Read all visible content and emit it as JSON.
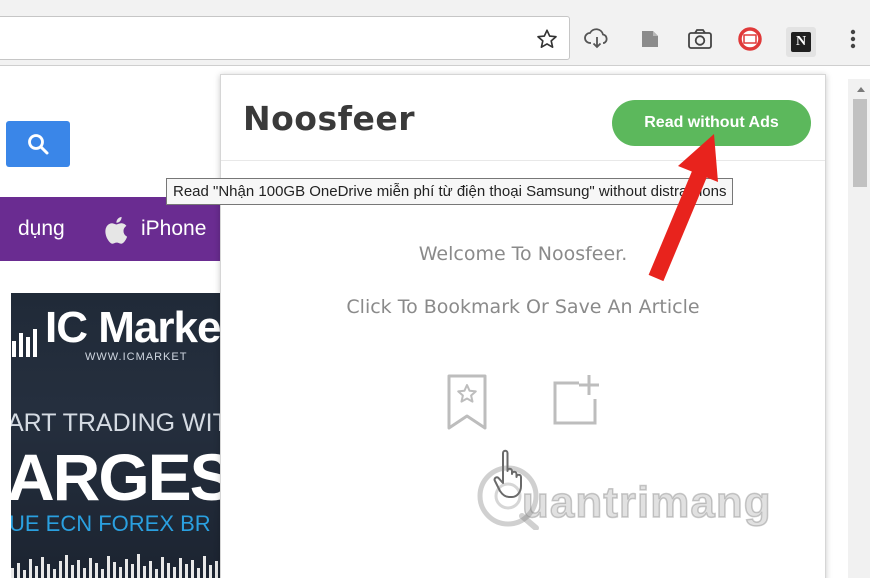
{
  "browser": {
    "toolbar_icons": [
      "star-icon",
      "cloud-download-icon",
      "note-icon",
      "camera-icon",
      "red-circle-icon",
      "noosfeer-extension-icon",
      "menu-icon"
    ],
    "extension_letter": "N"
  },
  "page": {
    "nav": {
      "item1": "dụng",
      "item2": "iPhone"
    },
    "ad": {
      "brand": "IC Marke",
      "url": "WWW.ICMARKET",
      "line1": "ART TRADING WIT",
      "line2": "ARGES",
      "line3": "UE ECN FOREX BR"
    }
  },
  "popup": {
    "logo": "Noosfeer",
    "read_button": "Read without Ads",
    "welcome": "Welcome To Noosfeer.",
    "instruction": "Click To Bookmark Or Save An Article"
  },
  "tooltip": {
    "text": "Read \"Nhận 100GB OneDrive miễn phí từ điện thoại Samsung\" without distractions"
  },
  "watermark": {
    "text": "uantrimang"
  },
  "colors": {
    "read_button": "#5cb85c",
    "search_button": "#3a86e8",
    "nav_bar": "#6a2c91",
    "arrow": "#e8231d"
  }
}
